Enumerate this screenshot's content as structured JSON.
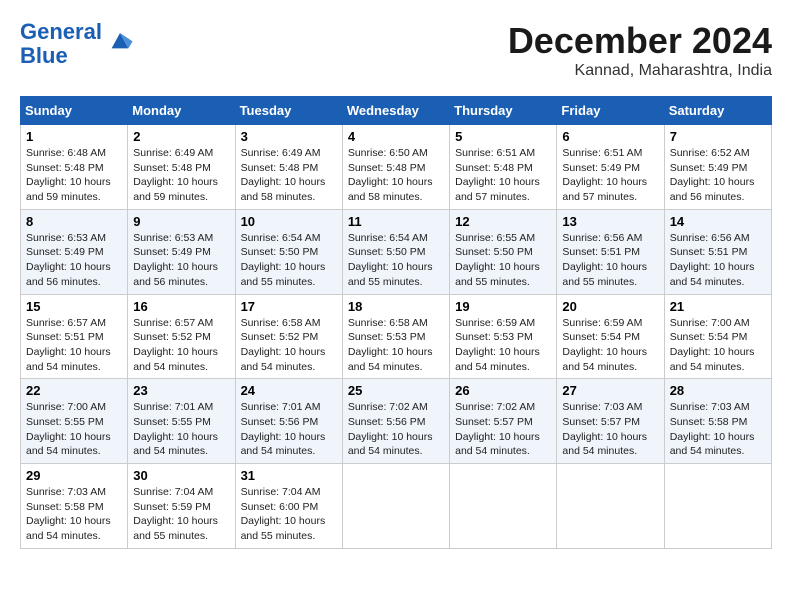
{
  "header": {
    "logo_line1": "General",
    "logo_line2": "Blue",
    "month_title": "December 2024",
    "location": "Kannad, Maharashtra, India"
  },
  "weekdays": [
    "Sunday",
    "Monday",
    "Tuesday",
    "Wednesday",
    "Thursday",
    "Friday",
    "Saturday"
  ],
  "weeks": [
    [
      {
        "day": "1",
        "info": "Sunrise: 6:48 AM\nSunset: 5:48 PM\nDaylight: 10 hours\nand 59 minutes."
      },
      {
        "day": "2",
        "info": "Sunrise: 6:49 AM\nSunset: 5:48 PM\nDaylight: 10 hours\nand 59 minutes."
      },
      {
        "day": "3",
        "info": "Sunrise: 6:49 AM\nSunset: 5:48 PM\nDaylight: 10 hours\nand 58 minutes."
      },
      {
        "day": "4",
        "info": "Sunrise: 6:50 AM\nSunset: 5:48 PM\nDaylight: 10 hours\nand 58 minutes."
      },
      {
        "day": "5",
        "info": "Sunrise: 6:51 AM\nSunset: 5:48 PM\nDaylight: 10 hours\nand 57 minutes."
      },
      {
        "day": "6",
        "info": "Sunrise: 6:51 AM\nSunset: 5:49 PM\nDaylight: 10 hours\nand 57 minutes."
      },
      {
        "day": "7",
        "info": "Sunrise: 6:52 AM\nSunset: 5:49 PM\nDaylight: 10 hours\nand 56 minutes."
      }
    ],
    [
      {
        "day": "8",
        "info": "Sunrise: 6:53 AM\nSunset: 5:49 PM\nDaylight: 10 hours\nand 56 minutes."
      },
      {
        "day": "9",
        "info": "Sunrise: 6:53 AM\nSunset: 5:49 PM\nDaylight: 10 hours\nand 56 minutes."
      },
      {
        "day": "10",
        "info": "Sunrise: 6:54 AM\nSunset: 5:50 PM\nDaylight: 10 hours\nand 55 minutes."
      },
      {
        "day": "11",
        "info": "Sunrise: 6:54 AM\nSunset: 5:50 PM\nDaylight: 10 hours\nand 55 minutes."
      },
      {
        "day": "12",
        "info": "Sunrise: 6:55 AM\nSunset: 5:50 PM\nDaylight: 10 hours\nand 55 minutes."
      },
      {
        "day": "13",
        "info": "Sunrise: 6:56 AM\nSunset: 5:51 PM\nDaylight: 10 hours\nand 55 minutes."
      },
      {
        "day": "14",
        "info": "Sunrise: 6:56 AM\nSunset: 5:51 PM\nDaylight: 10 hours\nand 54 minutes."
      }
    ],
    [
      {
        "day": "15",
        "info": "Sunrise: 6:57 AM\nSunset: 5:51 PM\nDaylight: 10 hours\nand 54 minutes."
      },
      {
        "day": "16",
        "info": "Sunrise: 6:57 AM\nSunset: 5:52 PM\nDaylight: 10 hours\nand 54 minutes."
      },
      {
        "day": "17",
        "info": "Sunrise: 6:58 AM\nSunset: 5:52 PM\nDaylight: 10 hours\nand 54 minutes."
      },
      {
        "day": "18",
        "info": "Sunrise: 6:58 AM\nSunset: 5:53 PM\nDaylight: 10 hours\nand 54 minutes."
      },
      {
        "day": "19",
        "info": "Sunrise: 6:59 AM\nSunset: 5:53 PM\nDaylight: 10 hours\nand 54 minutes."
      },
      {
        "day": "20",
        "info": "Sunrise: 6:59 AM\nSunset: 5:54 PM\nDaylight: 10 hours\nand 54 minutes."
      },
      {
        "day": "21",
        "info": "Sunrise: 7:00 AM\nSunset: 5:54 PM\nDaylight: 10 hours\nand 54 minutes."
      }
    ],
    [
      {
        "day": "22",
        "info": "Sunrise: 7:00 AM\nSunset: 5:55 PM\nDaylight: 10 hours\nand 54 minutes."
      },
      {
        "day": "23",
        "info": "Sunrise: 7:01 AM\nSunset: 5:55 PM\nDaylight: 10 hours\nand 54 minutes."
      },
      {
        "day": "24",
        "info": "Sunrise: 7:01 AM\nSunset: 5:56 PM\nDaylight: 10 hours\nand 54 minutes."
      },
      {
        "day": "25",
        "info": "Sunrise: 7:02 AM\nSunset: 5:56 PM\nDaylight: 10 hours\nand 54 minutes."
      },
      {
        "day": "26",
        "info": "Sunrise: 7:02 AM\nSunset: 5:57 PM\nDaylight: 10 hours\nand 54 minutes."
      },
      {
        "day": "27",
        "info": "Sunrise: 7:03 AM\nSunset: 5:57 PM\nDaylight: 10 hours\nand 54 minutes."
      },
      {
        "day": "28",
        "info": "Sunrise: 7:03 AM\nSunset: 5:58 PM\nDaylight: 10 hours\nand 54 minutes."
      }
    ],
    [
      {
        "day": "29",
        "info": "Sunrise: 7:03 AM\nSunset: 5:58 PM\nDaylight: 10 hours\nand 54 minutes."
      },
      {
        "day": "30",
        "info": "Sunrise: 7:04 AM\nSunset: 5:59 PM\nDaylight: 10 hours\nand 55 minutes."
      },
      {
        "day": "31",
        "info": "Sunrise: 7:04 AM\nSunset: 6:00 PM\nDaylight: 10 hours\nand 55 minutes."
      },
      null,
      null,
      null,
      null
    ]
  ]
}
